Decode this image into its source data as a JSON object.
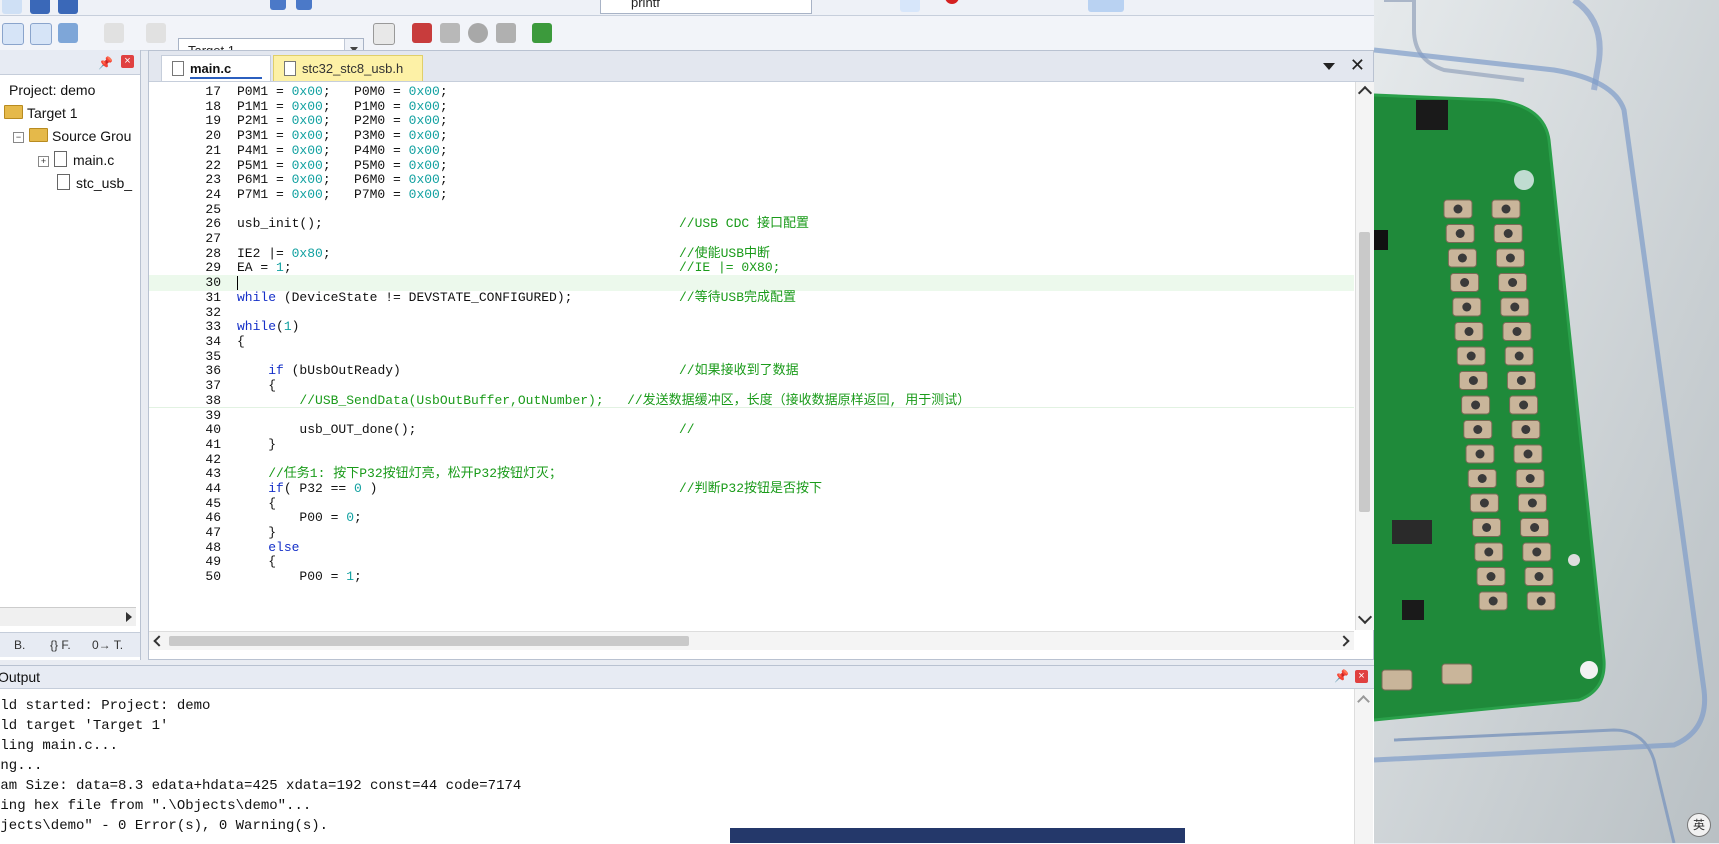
{
  "toolbar": {
    "target_value": "Target 1",
    "top_field_fragment": "printf"
  },
  "project_panel": {
    "root": "Project: demo",
    "target": "Target 1",
    "group": "Source Grou",
    "files": [
      "main.c",
      "stc_usb_"
    ],
    "bottom_tabs": [
      "B.",
      "{} F.",
      "0→ T."
    ]
  },
  "editor": {
    "tabs": [
      {
        "label": "main.c",
        "active": true
      },
      {
        "label": "stc32_stc8_usb.h",
        "active": false
      }
    ],
    "lines": [
      {
        "n": "17",
        "code": "P0M1 = 0x00;   P0M0 = 0x00;",
        "comment": ""
      },
      {
        "n": "18",
        "code": "P1M1 = 0x00;   P1M0 = 0x00;",
        "comment": ""
      },
      {
        "n": "19",
        "code": "P2M1 = 0x00;   P2M0 = 0x00;",
        "comment": ""
      },
      {
        "n": "20",
        "code": "P3M1 = 0x00;   P3M0 = 0x00;",
        "comment": ""
      },
      {
        "n": "21",
        "code": "P4M1 = 0x00;   P4M0 = 0x00;",
        "comment": ""
      },
      {
        "n": "22",
        "code": "P5M1 = 0x00;   P5M0 = 0x00;",
        "comment": ""
      },
      {
        "n": "23",
        "code": "P6M1 = 0x00;   P6M0 = 0x00;",
        "comment": ""
      },
      {
        "n": "24",
        "code": "P7M1 = 0x00;   P7M0 = 0x00;",
        "comment": ""
      },
      {
        "n": "25",
        "code": "",
        "comment": ""
      },
      {
        "n": "26",
        "code": "usb_init();",
        "comment": "//USB CDC 接口配置"
      },
      {
        "n": "27",
        "code": "",
        "comment": ""
      },
      {
        "n": "28",
        "code": "IE2 |= 0x80;",
        "comment": "//使能USB中断"
      },
      {
        "n": "29",
        "code": "EA = 1;",
        "comment": "//IE |= 0X80;"
      },
      {
        "n": "30",
        "code": "",
        "comment": ""
      },
      {
        "n": "31",
        "code": "while (DeviceState != DEVSTATE_CONFIGURED);",
        "comment": "//等待USB完成配置"
      },
      {
        "n": "32",
        "code": "",
        "comment": ""
      },
      {
        "n": "33",
        "code": "while(1)",
        "comment": ""
      },
      {
        "n": "34",
        "code": "{",
        "comment": ""
      },
      {
        "n": "35",
        "code": "",
        "comment": ""
      },
      {
        "n": "36",
        "code": "    if (bUsbOutReady)",
        "comment": "//如果接收到了数据"
      },
      {
        "n": "37",
        "code": "    {",
        "comment": ""
      },
      {
        "n": "38",
        "code": "        //USB_SendData(UsbOutBuffer,OutNumber);   //发送数据缓冲区，长度（接收数据原样返回, 用于测试）",
        "comment": ""
      },
      {
        "n": "39",
        "code": "",
        "comment": ""
      },
      {
        "n": "40",
        "code": "        usb_OUT_done();",
        "comment": "//"
      },
      {
        "n": "41",
        "code": "    }",
        "comment": ""
      },
      {
        "n": "42",
        "code": "",
        "comment": ""
      },
      {
        "n": "43",
        "code": "    //任务1: 按下P32按钮灯亮，松开P32按钮灯灭；",
        "comment": ""
      },
      {
        "n": "44",
        "code": "    if( P32 == 0 )",
        "comment": "//判断P32按钮是否按下"
      },
      {
        "n": "45",
        "code": "    {",
        "comment": ""
      },
      {
        "n": "46",
        "code": "        P00 = 0;",
        "comment": ""
      },
      {
        "n": "47",
        "code": "    }",
        "comment": ""
      },
      {
        "n": "48",
        "code": "    else",
        "comment": ""
      },
      {
        "n": "49",
        "code": "    {",
        "comment": ""
      },
      {
        "n": "50",
        "code": "        P00 = 1;",
        "comment": ""
      }
    ]
  },
  "output": {
    "title": "Output",
    "lines": [
      "ild started: Project: demo",
      "ild target 'Target 1'",
      "iling main.c...",
      "ing...",
      "ram Size: data=8.3 edata+hdata=425 xdata=192 const=44 code=7174",
      "ting hex file from \".\\Objects\\demo\"...",
      "bjects\\demo\" - 0 Error(s), 0 Warning(s)."
    ]
  },
  "ime_indicator": "英"
}
